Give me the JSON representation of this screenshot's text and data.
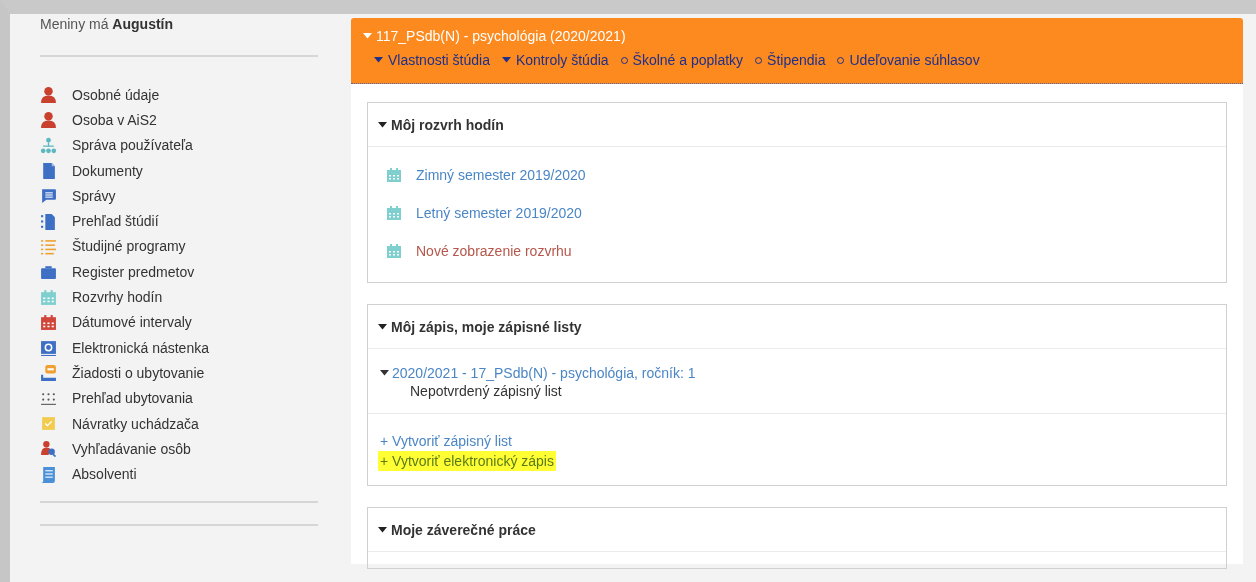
{
  "sidebar": {
    "greeting": "Meniny má **Augustín**",
    "items": [
      {
        "label": "Osobné údaje"
      },
      {
        "label": "Osoba v AiS2"
      },
      {
        "label": "Správa používateľa"
      },
      {
        "label": "Dokumenty"
      },
      {
        "label": "Správy"
      },
      {
        "label": "Prehľad štúdií"
      },
      {
        "label": "Študijné programy"
      },
      {
        "label": "Register predmetov"
      },
      {
        "label": "Rozvrhy hodín"
      },
      {
        "label": "Dátumové intervaly"
      },
      {
        "label": "Elektronická nástenka"
      },
      {
        "label": "Žiadosti o ubytovanie"
      },
      {
        "label": "Prehľad ubytovania"
      },
      {
        "label": "Návratky uchádzača"
      },
      {
        "label": "Vyhľadávanie osôb"
      },
      {
        "label": "Absolventi"
      }
    ]
  },
  "study": {
    "title": "117_PSdb(N) - psychológia (2020/2021)",
    "expanded": true,
    "links": [
      {
        "label": "Vlastnosti štúdia",
        "kind": "dropdown"
      },
      {
        "label": "Kontroly štúdia",
        "kind": "dropdown"
      },
      {
        "label": "Školné a poplatky",
        "kind": "link"
      },
      {
        "label": "Štipendia",
        "kind": "link"
      },
      {
        "label": "Udeľovanie súhlasov",
        "kind": "link"
      }
    ]
  },
  "schedule": {
    "title": "Môj rozvrh hodín",
    "expanded": true,
    "links": [
      {
        "label": "Zimný semester 2019/2020",
        "color": "#4a86c5"
      },
      {
        "label": "Letný semester 2019/2020",
        "color": "#4a86c5"
      },
      {
        "label": "Nové zobrazenie rozvrhu",
        "color": "#b5574b"
      }
    ]
  },
  "enrollment": {
    "title": "Môj zápis, moje zápisné listy",
    "expanded": true,
    "entries": [
      {
        "label": "2020/2021 - 17_PSdb(N) - psychológia, ročník: 1",
        "status": "Nepotvrdený zápisný list",
        "expanded": true
      }
    ],
    "actions": [
      {
        "label": "+ Vytvoriť zápisný list",
        "highlighted": false
      },
      {
        "label": "+ Vytvoriť elektronický zápis",
        "highlighted": true
      }
    ]
  },
  "theses": {
    "title": "Moje záverečné práce",
    "expanded": true
  }
}
